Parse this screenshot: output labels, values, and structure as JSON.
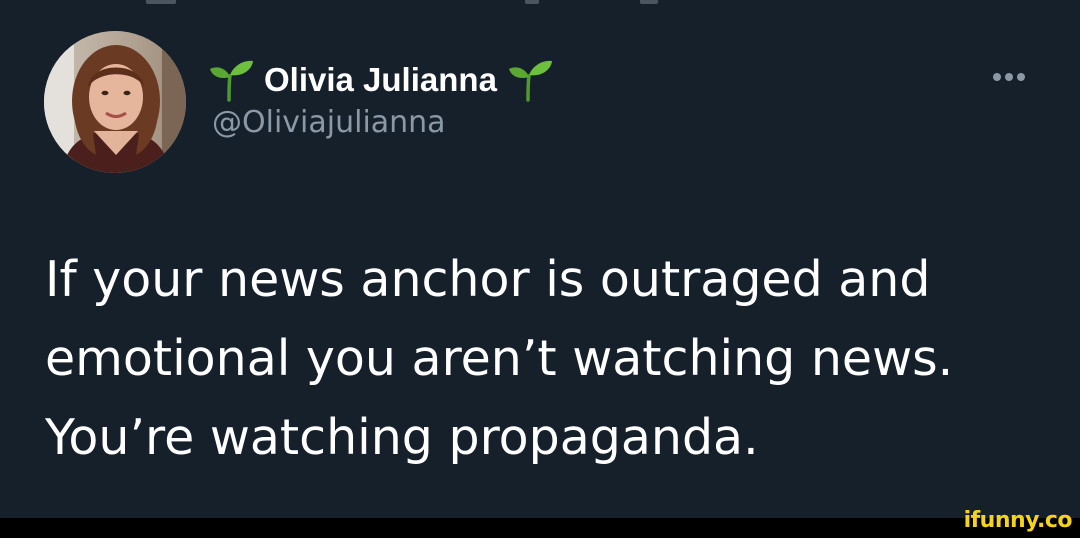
{
  "tweet": {
    "author": {
      "display_name": "Olivia Julianna",
      "handle": "@Oliviajulianna",
      "name_prefix_icon": "seedling-icon",
      "name_suffix_icon": "seedling-icon"
    },
    "text_lines": [
      "If your news anchor is outraged and",
      "emotional you aren’t watching news.",
      "You’re watching propaganda."
    ],
    "more_icon": "more-dots-icon"
  },
  "watermark": {
    "text": "ifunny.co"
  },
  "colors": {
    "background": "#15202b",
    "primary_text": "#ffffff",
    "secondary_text": "#8b98a5",
    "watermark": "#f7d21c",
    "seedling_green": "#5aa832"
  }
}
